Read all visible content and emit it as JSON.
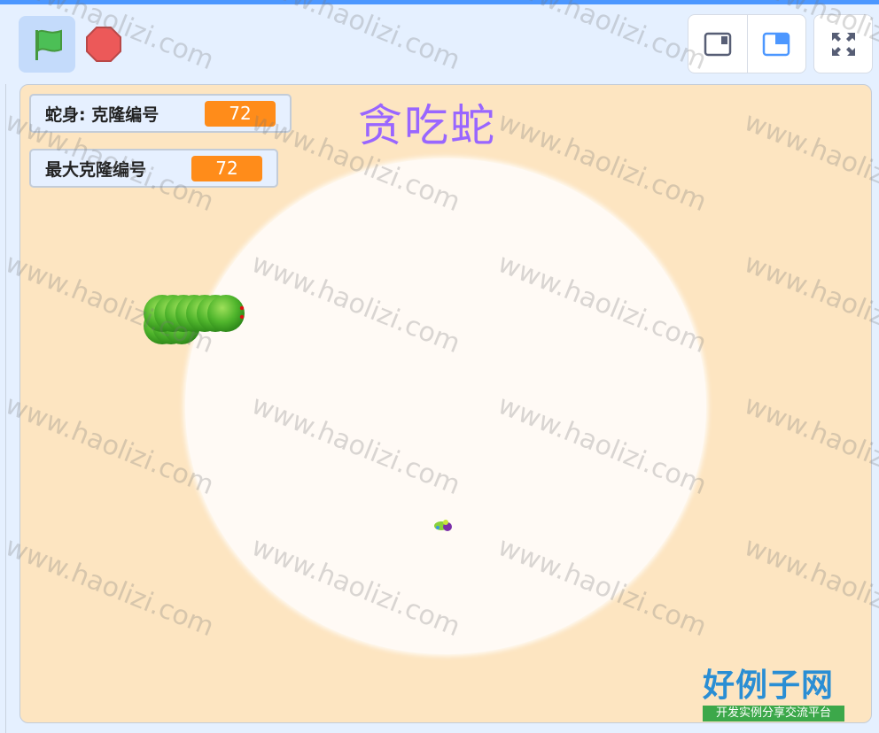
{
  "toolbar": {
    "green_flag_icon": "green-flag-icon",
    "stop_icon": "stop-icon",
    "small_stage_icon": "small-stage-icon",
    "normal_stage_icon": "normal-stage-icon",
    "fullscreen_icon": "fullscreen-icon"
  },
  "stage": {
    "title": "贪吃蛇",
    "monitors": [
      {
        "label": "蛇身: 克隆编号",
        "value": "72"
      },
      {
        "label": "最大克隆编号",
        "value": "72"
      }
    ]
  },
  "watermark": {
    "text": "www.haolizi.com",
    "brand_main": "好例子网",
    "brand_sub": "开发实例分享交流平台"
  },
  "colors": {
    "accent": "#4c97ff",
    "stage_background": "#fde5c1",
    "monitor_value": "#ff8c1a",
    "title": "#9966ff",
    "brand_blue": "#2a8ed4",
    "brand_green": "#3ca84a"
  }
}
